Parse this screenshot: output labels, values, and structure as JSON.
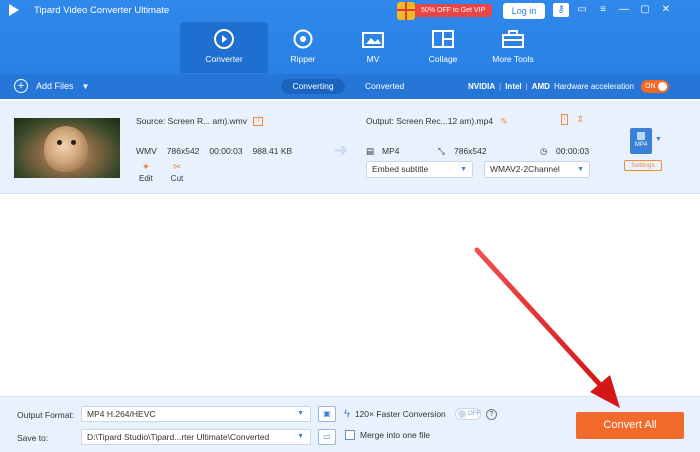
{
  "app": {
    "title": "Tipard Video Converter Ultimate"
  },
  "promo": {
    "label": "50% OFF to Get VIP"
  },
  "header": {
    "login_label": "Log in"
  },
  "nav": [
    {
      "label": "Converter",
      "icon": "converter-icon",
      "active": true
    },
    {
      "label": "Ripper",
      "icon": "disc-icon",
      "active": false
    },
    {
      "label": "MV",
      "icon": "mv-icon",
      "active": false
    },
    {
      "label": "Collage",
      "icon": "collage-icon",
      "active": false
    },
    {
      "label": "More Tools",
      "icon": "toolbox-icon",
      "active": false
    }
  ],
  "toolbar": {
    "add_files_label": "Add Files",
    "tab_converting": "Converting",
    "tab_converted": "Converted",
    "hw_nvidia": "NVIDIA",
    "hw_intel": "Intel",
    "hw_amd": "AMD",
    "hw_label": "Hardware acceleration",
    "hw_toggle": "ON"
  },
  "file": {
    "source": "Source: Screen R... am).wmv",
    "format": "WMV",
    "resolution": "786x542",
    "duration": "00:00:03",
    "size": "988.41 KB",
    "edit_label": "Edit",
    "cut_label": "Cut",
    "output": "Output: Screen Rec...12 am).mp4",
    "out_format": "MP4",
    "out_resolution": "786x542",
    "out_duration": "00:00:03",
    "subtitle": "Embed subtitle",
    "audio": "WMAV2-2Channel",
    "format_badge": "MP4",
    "settings_label": "Settings"
  },
  "bottom": {
    "output_format_label": "Output Format:",
    "output_format_value": "MP4 H.264/HEVC",
    "save_to_label": "Save to:",
    "save_to_value": "D:\\Tipard Studio\\Tipard...rter Ultimate\\Converted",
    "faster_label": "120× Faster Conversion",
    "faster_toggle": "OFF",
    "merge_label": "Merge into one file",
    "convert_all_label": "Convert All"
  },
  "colors": {
    "brand": "#2a80e4",
    "accent": "#f26b2c",
    "arrow": "#e02020"
  }
}
